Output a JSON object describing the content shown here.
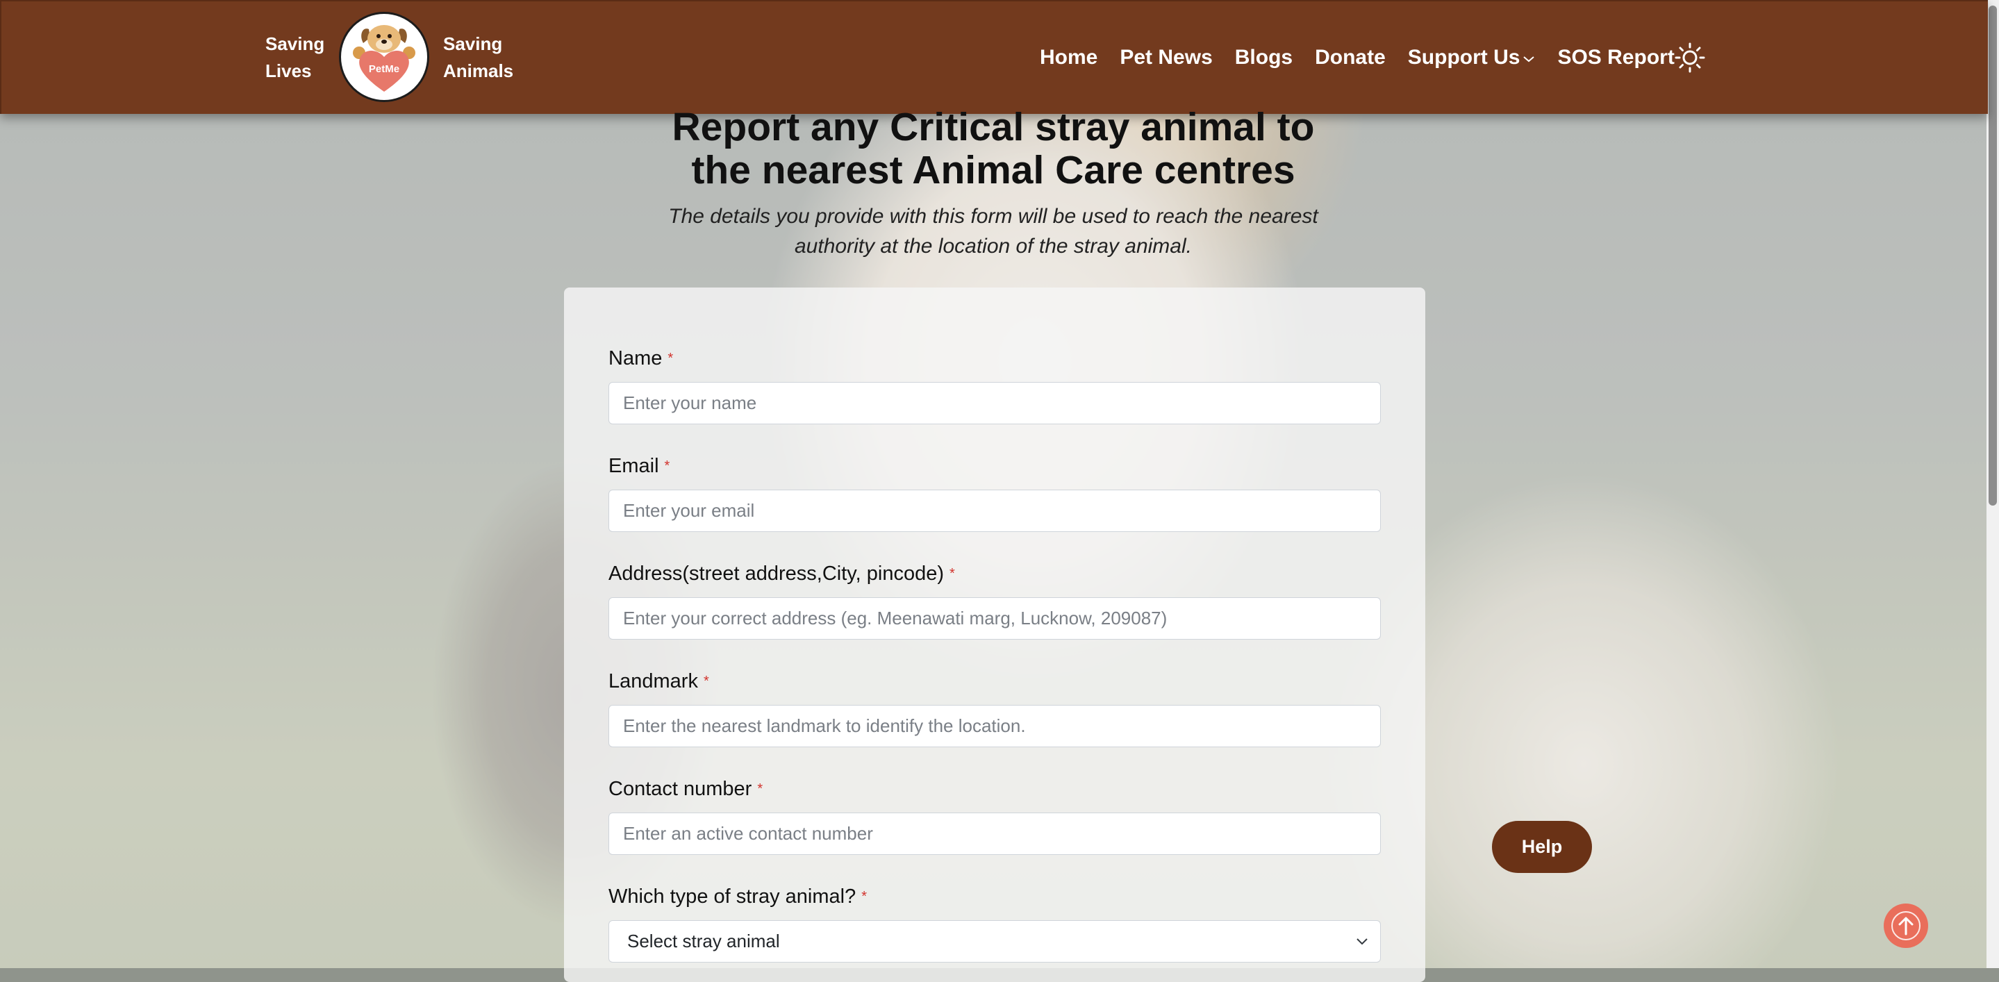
{
  "colors": {
    "navbar": "#733a1e",
    "help_button": "#6a3216",
    "required_marker": "#d2332d",
    "scroll_top_button": "#e96e5b"
  },
  "brand": {
    "tagline_left": [
      "Saving",
      "Lives"
    ],
    "tagline_right": [
      "Saving",
      "Animals"
    ],
    "logo_text": "PetMe"
  },
  "nav": {
    "items": [
      "Home",
      "Pet News",
      "Blogs",
      "Donate",
      "Support Us",
      "SOS Report"
    ],
    "support_dropdown_icon": "chevron-down-icon",
    "theme_icon": "sun-icon"
  },
  "hero": {
    "title_line1": "Report any Critical stray animal to",
    "title_line2": "the nearest Animal Care centres",
    "subtitle_line1": "The details you provide with this form will be used to reach the nearest",
    "subtitle_line2": "authority at the location of the stray animal."
  },
  "form": {
    "required_mark": "*",
    "fields": [
      {
        "label": "Name",
        "placeholder": "Enter your name",
        "value": ""
      },
      {
        "label": "Email",
        "placeholder": "Enter your email",
        "value": ""
      },
      {
        "label": "Address(street address,City, pincode)",
        "placeholder": "Enter your correct address (eg. Meenawati marg, Lucknow, 209087)",
        "value": ""
      },
      {
        "label": "Landmark",
        "placeholder": "Enter the nearest landmark to identify the location.",
        "value": ""
      },
      {
        "label": "Contact number",
        "placeholder": "Enter an active contact number",
        "value": ""
      }
    ],
    "animal_type": {
      "label": "Which type of stray animal?",
      "selected": "Select stray animal"
    }
  },
  "help_button": "Help",
  "scroll_top_icon": "arrow-up-icon"
}
